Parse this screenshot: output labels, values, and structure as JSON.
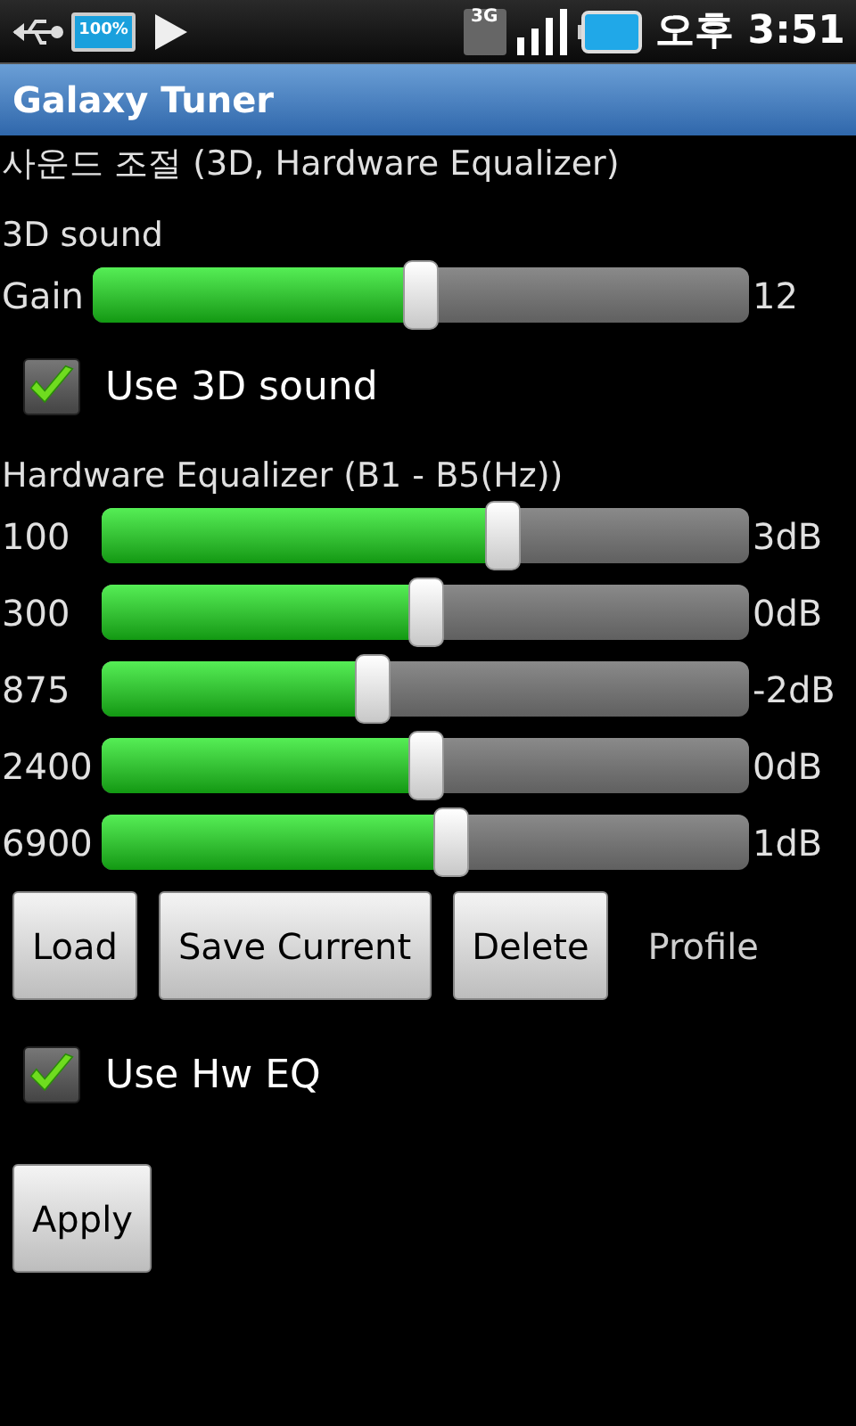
{
  "status_bar": {
    "battery_label": "100%",
    "network": "3G",
    "time": "오후 3:51"
  },
  "window": {
    "title": "Galaxy Tuner"
  },
  "subtitle": "사운드 조절 (3D, Hardware Equalizer)",
  "sound3d": {
    "heading": "3D sound",
    "slider": {
      "label": "Gain",
      "level": 0.5,
      "reading": "12"
    },
    "checkbox": {
      "label": "Use 3D sound",
      "checked": true
    }
  },
  "equalizer": {
    "heading": "Hardware Equalizer (B1 - B5(Hz))",
    "bands": [
      {
        "label": "100",
        "level": 0.62,
        "reading": "3dB"
      },
      {
        "label": "300",
        "level": 0.5,
        "reading": "0dB"
      },
      {
        "label": "875",
        "level": 0.42,
        "reading": "-2dB"
      },
      {
        "label": "2400",
        "level": 0.5,
        "reading": "0dB"
      },
      {
        "label": "6900",
        "level": 0.54,
        "reading": "1dB"
      }
    ]
  },
  "profile_buttons": [
    "Load",
    "Save Current",
    "Delete"
  ],
  "profile_label": "Profile",
  "hw_checkbox": {
    "label": "Use Hw EQ",
    "checked": true
  },
  "apply_button": "Apply"
}
